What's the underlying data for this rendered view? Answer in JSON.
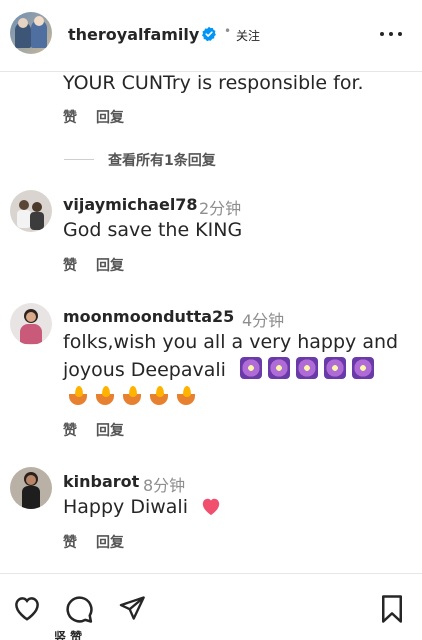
{
  "header": {
    "username": "theroyalfamily",
    "separator": "•",
    "follow_label": "关注"
  },
  "reply_block": {
    "text": "YOUR CUNTry is responsible for.",
    "like_label": "赞",
    "reply_label": "回复",
    "view_all_label": "查看所有1条回复"
  },
  "comments": [
    {
      "username": "vijaymichael78",
      "time": "2分钟",
      "lines": [
        "God save the KING"
      ],
      "like_label": "赞",
      "reply_label": "回复"
    },
    {
      "username": "moonmoondutta25",
      "time": "4分钟",
      "lines": [
        "folks,wish you all a very happy and",
        "joyous Deepavali"
      ],
      "emoji_row1": [
        "sparkler-emoji",
        "sparkler-emoji",
        "sparkler-emoji",
        "sparkler-emoji",
        "sparkler-emoji"
      ],
      "emoji_row2": [
        "diya-lamp-emoji",
        "diya-lamp-emoji",
        "diya-lamp-emoji",
        "diya-lamp-emoji",
        "diya-lamp-emoji"
      ],
      "like_label": "赞",
      "reply_label": "回复"
    },
    {
      "username": "kinbarot",
      "time": "8分钟",
      "lines": [
        "Happy Diwali"
      ],
      "emoji": "heart-emoji",
      "like_label": "赞",
      "reply_label": "回复"
    }
  ],
  "bottom_bar": {
    "icons": [
      "heart-icon",
      "comment-icon",
      "share-icon",
      "bookmark-icon"
    ],
    "partial_text": "竖 赞"
  },
  "colors": {
    "text": "#262626",
    "secondary": "#8e8e8e",
    "verified_blue": "#0095f6",
    "heart_red": "#f0506e"
  }
}
